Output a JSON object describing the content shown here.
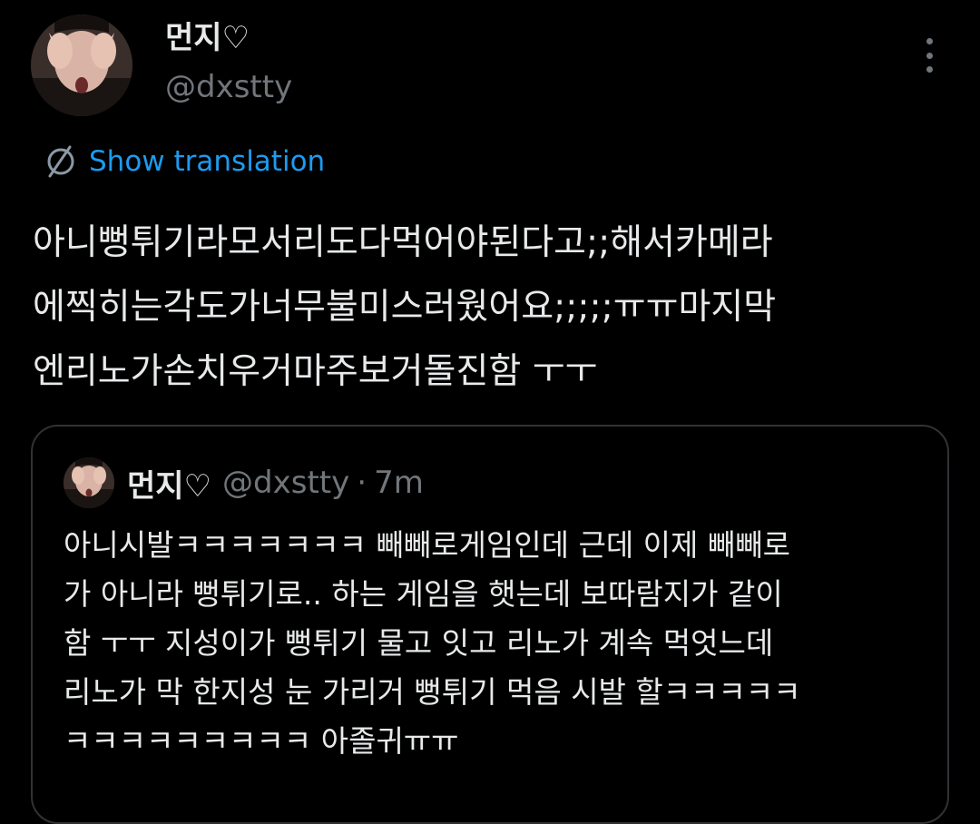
{
  "author": {
    "display_name": "먼지♡",
    "handle": "@dxstty"
  },
  "translation": {
    "label": "Show translation",
    "icon": "globe-icon"
  },
  "tweet": {
    "lines": [
      "아니뻥튀기라모서리도다먹어야된다고;;해서카메라",
      "에찍히는각도가너무불미스러웠어요;;;;;ㅠㅠ마지막",
      "엔리노가손치우거마주보거돌진함 ㅜㅜ"
    ]
  },
  "quote": {
    "display_name": "먼지♡",
    "handle": "@dxstty",
    "separator": "·",
    "time": "7m",
    "lines": [
      "아니시발ㅋㅋㅋㅋㅋㅋㅋ 빼빼로게임인데 근데 이제 빼빼로",
      "가 아니라 뻥튀기로.. 하는 게임을 햇는데 보따람지가 같이",
      "함 ㅜㅜ 지성이가 뻥튀기 물고 잇고 리노가 계속 먹엇느데",
      "리노가 막 한지성 눈 가리거 뻥튀기 먹음 시발 할ㅋㅋㅋㅋㅋ",
      "ㅋㅋㅋㅋㅋㅋㅋㅋㅋ 아졸귀ㅠㅠ"
    ]
  },
  "colors": {
    "background": "#000000",
    "text": "#e7e9ea",
    "secondary": "#71767b",
    "link": "#1d9bf0",
    "border": "#2f3336"
  }
}
